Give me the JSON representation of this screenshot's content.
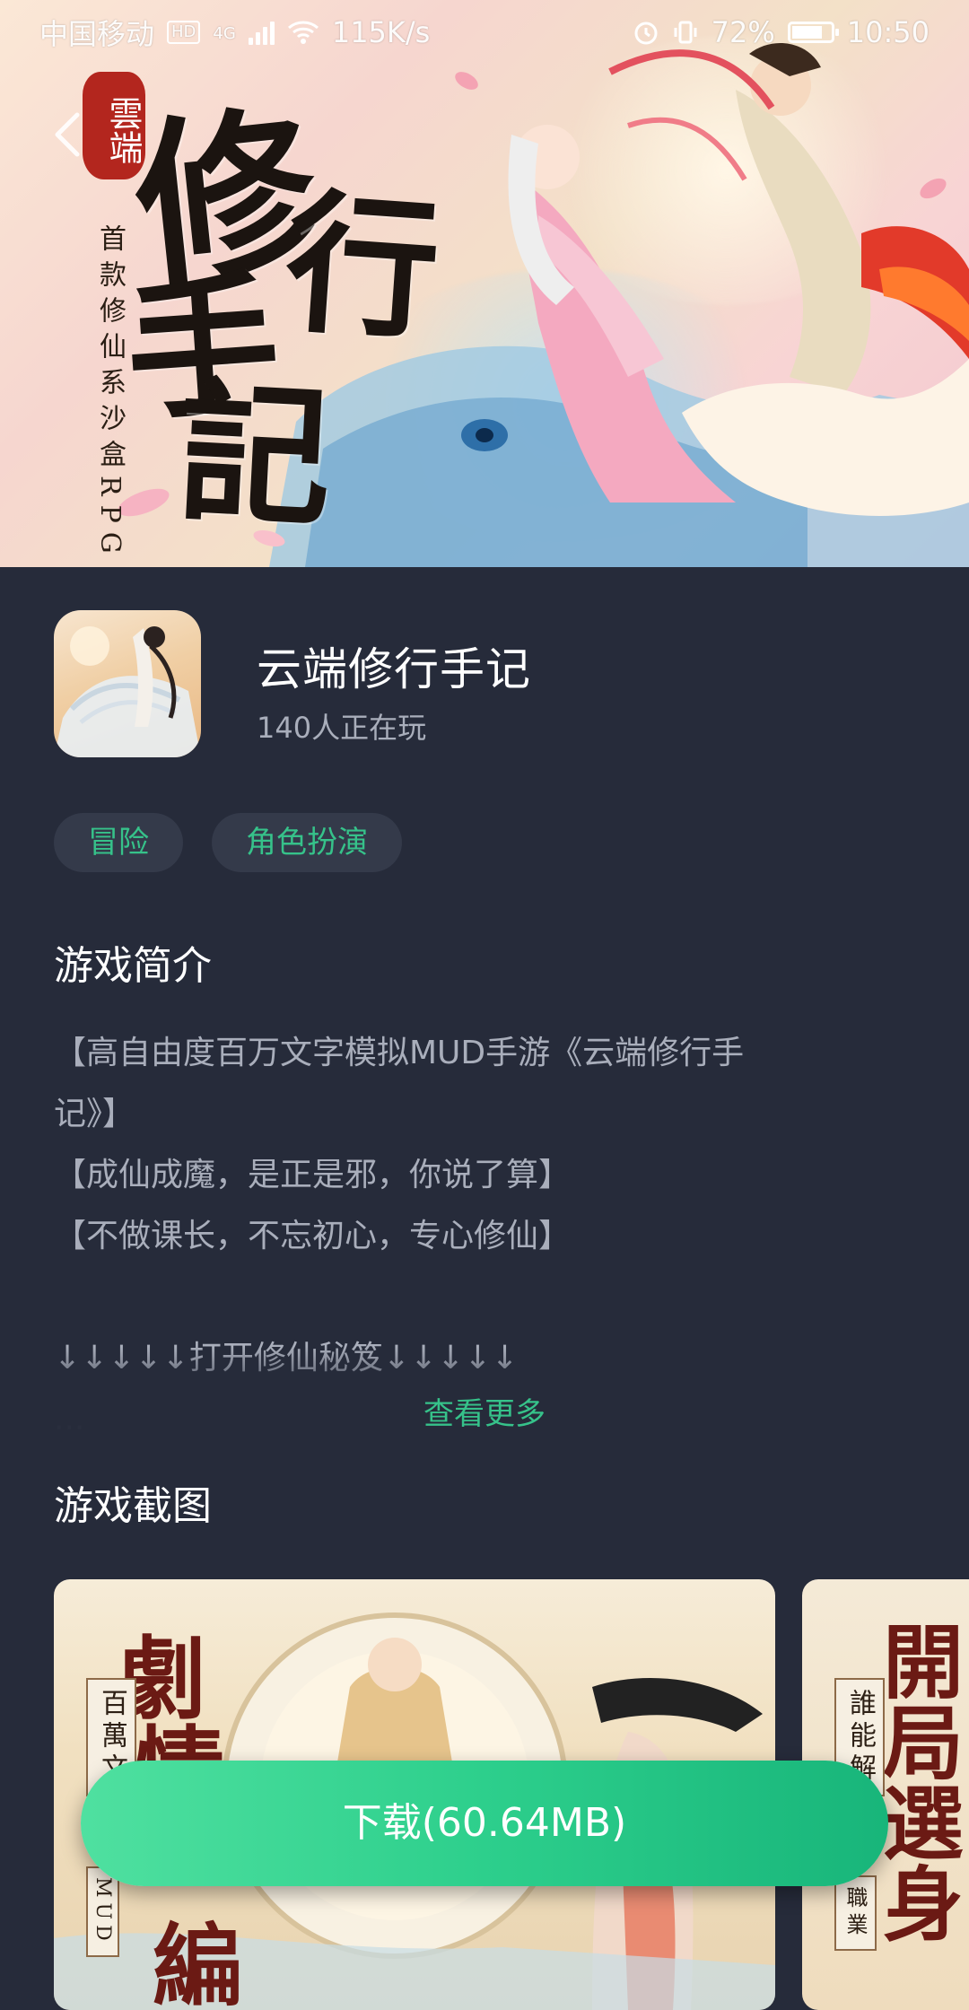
{
  "status_bar": {
    "carrier": "中国移动",
    "network_badge": "HD",
    "network_type": "4G",
    "speed": "115K/s",
    "battery": "72%",
    "time": "10:50"
  },
  "banner": {
    "seal_text": "雲端",
    "title_chars": [
      "修",
      "行",
      "手",
      "記"
    ],
    "subtitle": "首款修仙系沙盒RPG"
  },
  "app": {
    "name": "云端修行手记",
    "playing": "140人正在玩"
  },
  "tags": [
    "冒险",
    "角色扮演"
  ],
  "intro": {
    "title": "游戏简介",
    "lines": [
      "【高自由度百万文字模拟MUD手游《云端修行手",
      "记》】",
      "【成仙成魔，是正是邪，你说了算】",
      "【不做课长，不忘初心，专心修仙】",
      "",
      "↓↓↓↓↓打开修仙秘笈↓↓↓↓↓",
      "..."
    ],
    "more": "查看更多"
  },
  "screenshots": {
    "title": "游戏截图",
    "shot1": {
      "big1": "劇",
      "big2": "情",
      "big3": "編",
      "ribbon": "百萬文",
      "ribbon2": "MUD"
    },
    "shot2": {
      "big1": "開",
      "big2": "局",
      "big3": "選",
      "big4": "身",
      "ribbon": "誰能解",
      "ribbon2": "職業"
    }
  },
  "download": {
    "label": "下载(60.64MB)"
  },
  "colors": {
    "background": "#262b3a",
    "accent": "#36c28a",
    "tag_bg": "#343a4a",
    "muted_text": "#a9aebb"
  }
}
